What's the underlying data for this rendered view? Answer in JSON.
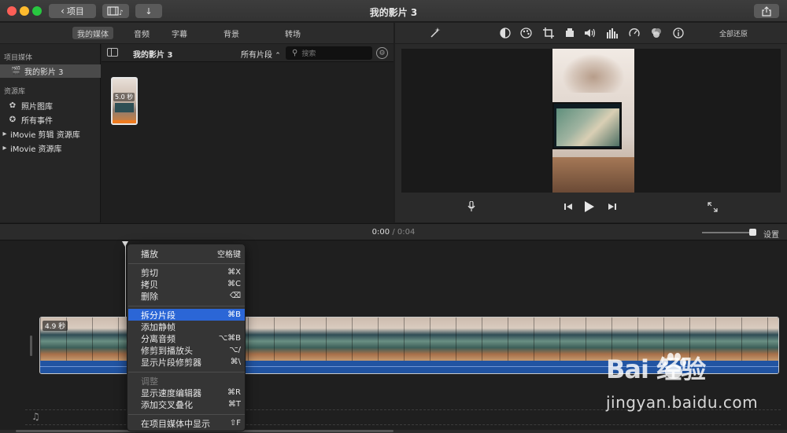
{
  "window": {
    "title": "我的影片 3",
    "back_label": "项目"
  },
  "media_tabs": [
    {
      "label": "我的媒体",
      "active": true
    },
    {
      "label": "音频",
      "active": false
    },
    {
      "label": "字幕",
      "active": false
    },
    {
      "label": "背景",
      "active": false
    },
    {
      "label": "转场",
      "active": false
    }
  ],
  "adjust_toolbar": {
    "icons": [
      "magic-wand-icon",
      "color-balance-icon",
      "color-correction-icon",
      "crop-icon",
      "stabilization-icon",
      "volume-icon",
      "equalizer-icon",
      "speed-icon",
      "clip-filter-icon",
      "info-icon"
    ],
    "reset_all_label": "全部还原"
  },
  "sidebar": {
    "project_media_heading": "项目媒体",
    "project_item": "我的影片 3",
    "libraries_heading": "资源库",
    "items": [
      {
        "label": "照片图库",
        "icon": "flower-icon"
      },
      {
        "label": "所有事件",
        "icon": "star-icon"
      },
      {
        "label": "iMovie 剪辑 资源库",
        "icon": "disclosure-triangle-icon"
      },
      {
        "label": "iMovie 资源库",
        "icon": "disclosure-triangle-icon"
      }
    ]
  },
  "browser": {
    "title": "我的影片 3",
    "filter_label": "所有片段",
    "search_placeholder": "搜索",
    "clip_duration": "5.0 秒"
  },
  "timeline": {
    "current_time": "0:00",
    "separator": "/",
    "total_time": "0:04",
    "settings_label": "设置",
    "zoom_level": 0.95,
    "clip_duration": "4.9 秒"
  },
  "context_menu": {
    "groups": [
      [
        {
          "label": "播放",
          "shortcut": "空格键",
          "state": "normal"
        }
      ],
      [
        {
          "label": "剪切",
          "shortcut": "⌘X",
          "state": "normal"
        },
        {
          "label": "拷贝",
          "shortcut": "⌘C",
          "state": "normal"
        },
        {
          "label": "删除",
          "shortcut": "⌫",
          "state": "normal"
        }
      ],
      [
        {
          "label": "拆分片段",
          "shortcut": "⌘B",
          "state": "highlighted"
        },
        {
          "label": "添加静帧",
          "shortcut": "",
          "state": "normal"
        },
        {
          "label": "分离音频",
          "shortcut": "⌥⌘B",
          "state": "normal"
        },
        {
          "label": "修剪到播放头",
          "shortcut": "⌥/",
          "state": "normal"
        },
        {
          "label": "显示片段修剪器",
          "shortcut": "⌘\\",
          "state": "normal"
        }
      ],
      [
        {
          "label": "调整",
          "shortcut": "",
          "state": "disabled"
        },
        {
          "label": "显示速度编辑器",
          "shortcut": "⌘R",
          "state": "normal"
        },
        {
          "label": "添加交叉叠化",
          "shortcut": "⌘T",
          "state": "normal"
        }
      ],
      [
        {
          "label": "在项目媒体中显示",
          "shortcut": "⇧F",
          "state": "normal"
        }
      ]
    ]
  },
  "watermark": {
    "logo_text": "Bai  经验",
    "url": "jingyan.baidu.com"
  },
  "colors": {
    "highlight": "#2b66d6",
    "audio_track": "#2154a2",
    "clip_bar": "#ee7b20"
  }
}
